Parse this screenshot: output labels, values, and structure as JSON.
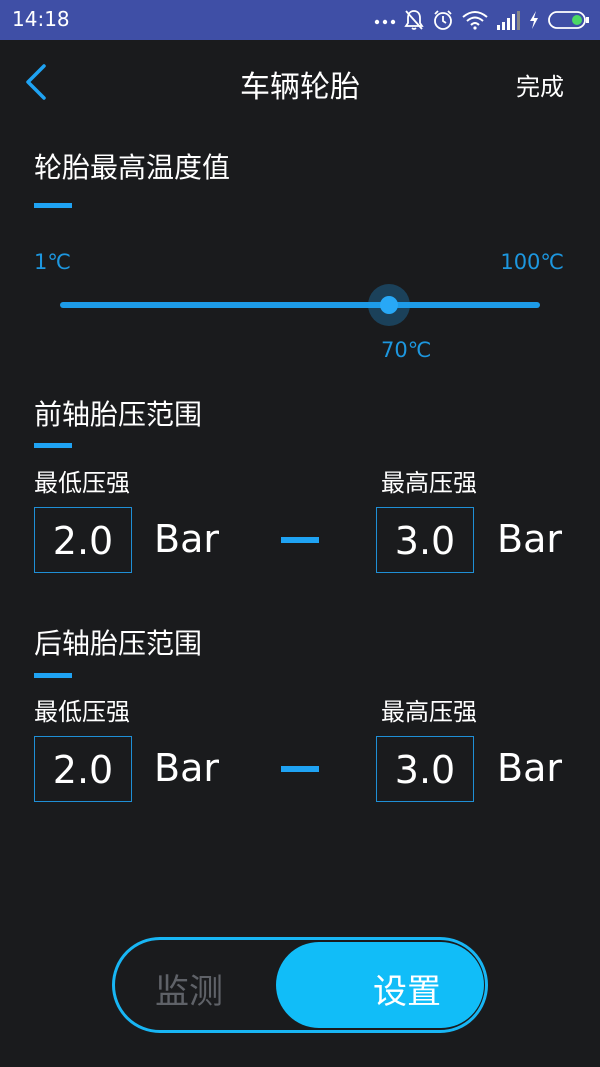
{
  "status_bar": {
    "time": "14:18",
    "icons": [
      "more-dots-icon",
      "mute-bell-icon",
      "alarm-icon",
      "wifi-icon",
      "signal-icon",
      "charging-icon",
      "battery-icon"
    ]
  },
  "header": {
    "title": "车辆轮胎",
    "done_label": "完成",
    "back_icon": "chevron-left-icon"
  },
  "temperature": {
    "title": "轮胎最高温度值",
    "min_label": "1℃",
    "max_label": "100℃",
    "min": 1,
    "max": 100,
    "value": 70,
    "value_label": "70℃"
  },
  "front_axle": {
    "title": "前轴胎压范围",
    "min_label": "最低压强",
    "max_label": "最高压强",
    "min_value": "2.0",
    "max_value": "3.0",
    "unit": "Bar"
  },
  "rear_axle": {
    "title": "后轴胎压范围",
    "min_label": "最低压强",
    "max_label": "最高压强",
    "min_value": "2.0",
    "max_value": "3.0",
    "unit": "Bar"
  },
  "bottom_tabs": {
    "items": [
      {
        "label": "监测",
        "active": false
      },
      {
        "label": "设置",
        "active": true
      }
    ]
  },
  "colors": {
    "accent": "#1fa3f3",
    "toggle_active": "#11bdf8",
    "background": "#1a1b1d",
    "status_bar": "#3f4fa6"
  }
}
